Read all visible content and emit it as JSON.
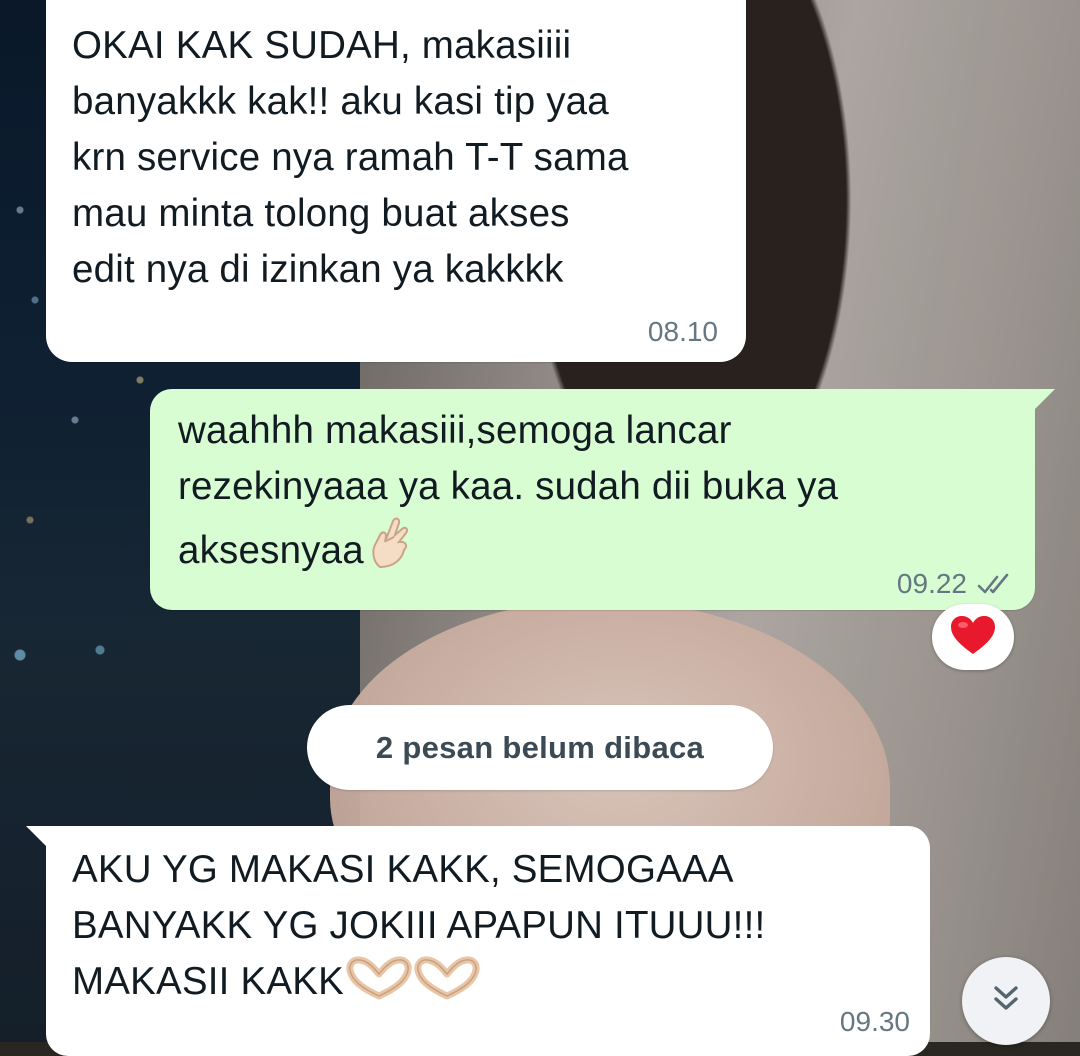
{
  "wallpaper": {
    "description_icon": "photo-wallpaper"
  },
  "messages": [
    {
      "direction": "incoming",
      "lines": [
        "OKAI KAK SUDAH, makasiiii",
        "banyakkk kak!! aku kasi tip yaa",
        "krn service nya ramah T-T sama",
        "mau minta tolong buat akses",
        "edit nya di izinkan ya kakkkk"
      ],
      "time": "08.10"
    },
    {
      "direction": "outgoing",
      "lines": [
        "waahhh makasiii,semoga lancar",
        "rezekinyaaa ya kaa. sudah dii buka ya",
        "aksesnyaa"
      ],
      "emoji": "finger-heart-icon",
      "time": "09.22",
      "status": "read-double-check",
      "reaction": "red-heart"
    },
    {
      "direction": "incoming",
      "lines": [
        "AKU YG MAKASI KAKK, SEMOGAAA",
        "BANYAKK YG JOKIII APAPUN ITUUU!!!",
        "MAKASII KAKK"
      ],
      "emoji": "heart-hands-icon",
      "time": "09.30"
    }
  ],
  "unread_banner": "2 pesan belum dibaca",
  "colors": {
    "incoming": "#ffffff",
    "outgoing": "#d9fdd3",
    "meta": "#667781",
    "read_tick": "#53bdeb",
    "heart": "#e8192c"
  }
}
